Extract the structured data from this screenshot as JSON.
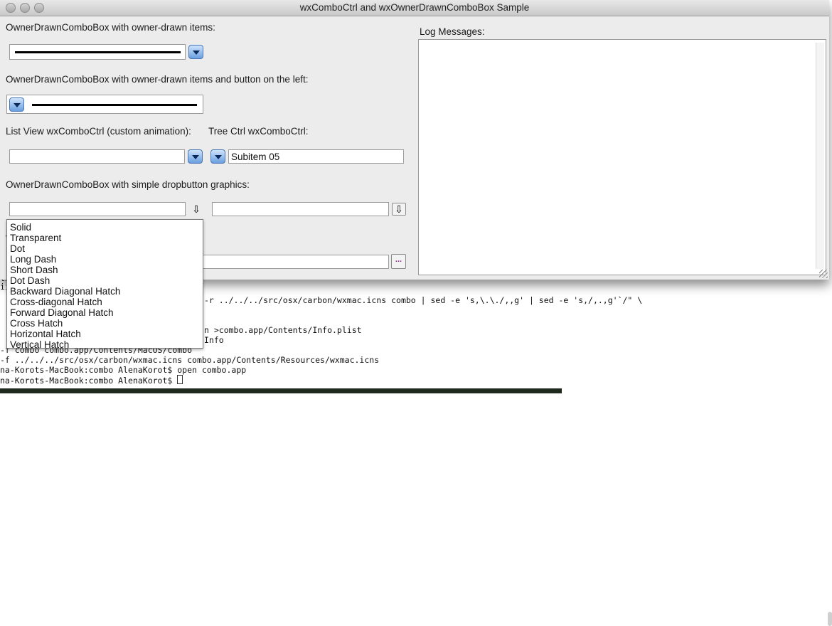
{
  "window": {
    "title": "wxComboCtrl and wxOwnerDrawnComboBox Sample"
  },
  "labels": {
    "owner_drawn": "OwnerDrawnComboBox with owner-drawn items:",
    "owner_drawn_left": "OwnerDrawnComboBox with owner-drawn items and button on the left:",
    "list_view": "List View wxComboCtrl (custom animation):",
    "tree_ctrl": "Tree Ctrl wxComboCtrl:",
    "simple_graphics": "OwnerDrawnComboBox with simple dropbutton graphics:",
    "log": "Log Messages:",
    "partial_hidden": "W"
  },
  "fields": {
    "list_view_value": "",
    "tree_ctrl_value": "Subitem 05",
    "simple1_value": "",
    "simple2_value": "",
    "bottom_value": "",
    "ellipsis_label": "..."
  },
  "popup": {
    "items": [
      "Solid",
      "Transparent",
      "Dot",
      "Long Dash",
      "Short Dash",
      "Dot Dash",
      "Backward Diagonal Hatch",
      "Cross-diagonal Hatch",
      "Forward Diagonal Hatch",
      "Cross Hatch",
      "Horizontal Hatch",
      "Vertical Hatch"
    ]
  },
  "terminal": {
    "lines": [
      "li",
      "ii",
      "-r ../../../src/osx/carbon/wxmac.icns combo | sed -e 's,\\.\\./,,g' | sed -e 's,/,.,g'`/\" \\",
      "n >combo.app/Contents/Info.plist",
      "Info",
      "-f combo combo.app/Contents/MacOS/combo",
      "-f ../../../src/osx/carbon/wxmac.icns combo.app/Contents/Resources/wxmac.icns",
      "na-Korots-MacBook:combo AlenaKorot$ open combo.app",
      "na-Korots-MacBook:combo AlenaKorot$ "
    ]
  },
  "colors": {
    "window_bg": "#ececec",
    "button_blue": "#6a9fe0"
  }
}
